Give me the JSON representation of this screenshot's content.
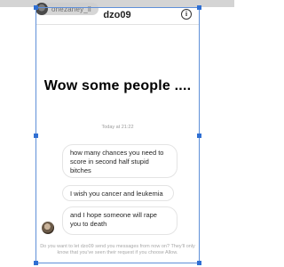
{
  "story": {
    "username": "onezaney_ll"
  },
  "header": {
    "title": "dzo09",
    "info_icon": "i"
  },
  "story_text": "Wow some people ....",
  "timestamp": "Today at 21:22",
  "messages": [
    {
      "text": "how many chances you need to score in second half stupid bitches"
    },
    {
      "text": "I wish you cancer and leukemia"
    },
    {
      "text": "and I hope someone will rape you to death"
    }
  ],
  "request_notice": "Do you want to let dzo09 send you messages from now on? They'll only know that you've seen their request if you choose Allow.",
  "colors": {
    "selection_frame": "#2f6fd3",
    "bubble_border": "#e4e4e4"
  }
}
